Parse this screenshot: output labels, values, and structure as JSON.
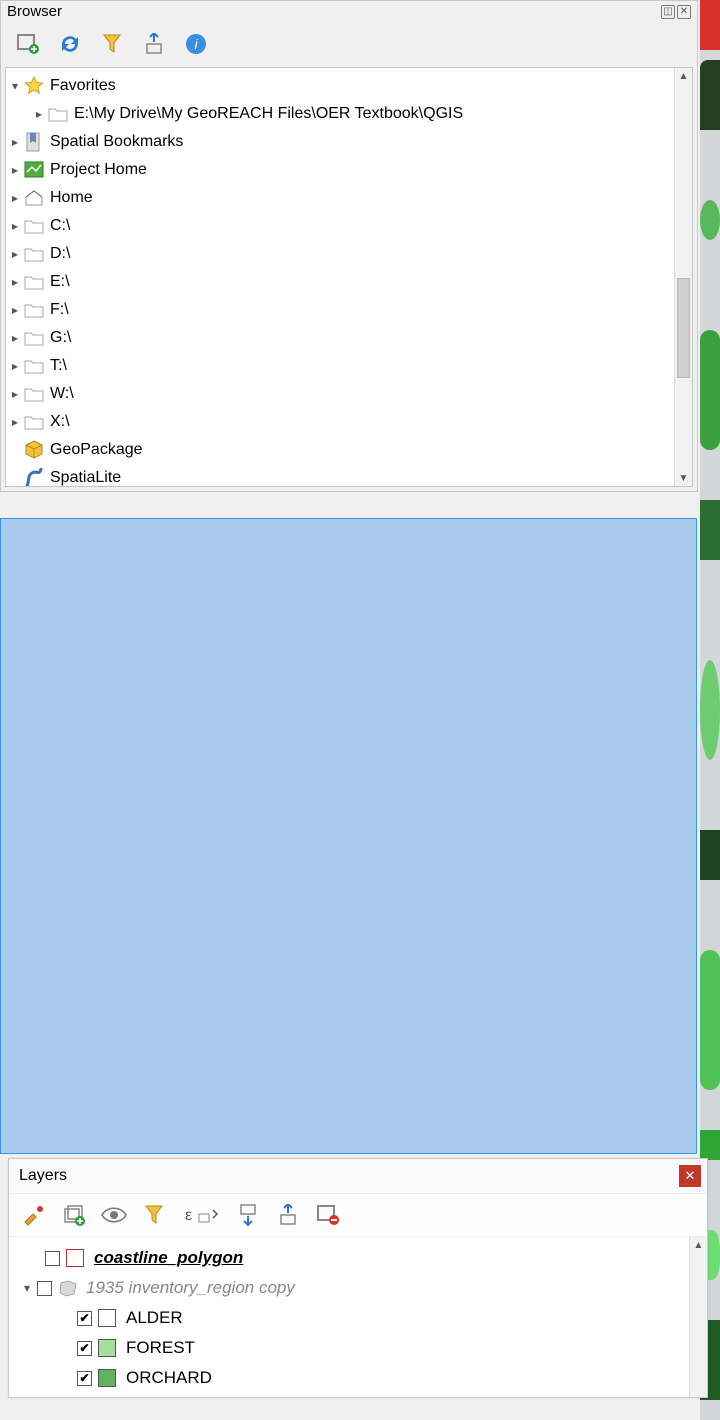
{
  "browser": {
    "title": "Browser",
    "toolbar_icons": [
      "add-layer",
      "refresh",
      "filter",
      "collapse",
      "info"
    ],
    "tree": {
      "favorites": {
        "label": "Favorites",
        "child": "E:\\My Drive\\My GeoREACH Files\\OER Textbook\\QGIS"
      },
      "items": [
        {
          "label": "Spatial Bookmarks",
          "icon": "bookmark"
        },
        {
          "label": "Project Home",
          "icon": "project"
        },
        {
          "label": "Home",
          "icon": "home"
        },
        {
          "label": "C:\\",
          "icon": "folder"
        },
        {
          "label": "D:\\",
          "icon": "folder"
        },
        {
          "label": "E:\\",
          "icon": "folder"
        },
        {
          "label": "F:\\",
          "icon": "folder"
        },
        {
          "label": "G:\\",
          "icon": "folder"
        },
        {
          "label": "T:\\",
          "icon": "folder"
        },
        {
          "label": "W:\\",
          "icon": "folder"
        },
        {
          "label": "X:\\",
          "icon": "folder"
        },
        {
          "label": "GeoPackage",
          "icon": "geopackage",
          "expandable": false
        },
        {
          "label": "SpatiaLite",
          "icon": "spatialite",
          "expandable": false
        }
      ]
    }
  },
  "layers": {
    "title": "Layers",
    "toolbar_icons": [
      "style",
      "add-group",
      "visibility",
      "filter",
      "expression",
      "expand-all",
      "collapse-all",
      "remove"
    ],
    "layers": {
      "coastline": "coastline_polygon",
      "group": "1935 inventory_region copy",
      "cat1": {
        "label": "ALDER",
        "color": "#ffffff"
      },
      "cat2": {
        "label": "FOREST",
        "color": "#a9dca1"
      },
      "cat3": {
        "label": "ORCHARD",
        "color": "#5fb25f"
      }
    }
  }
}
